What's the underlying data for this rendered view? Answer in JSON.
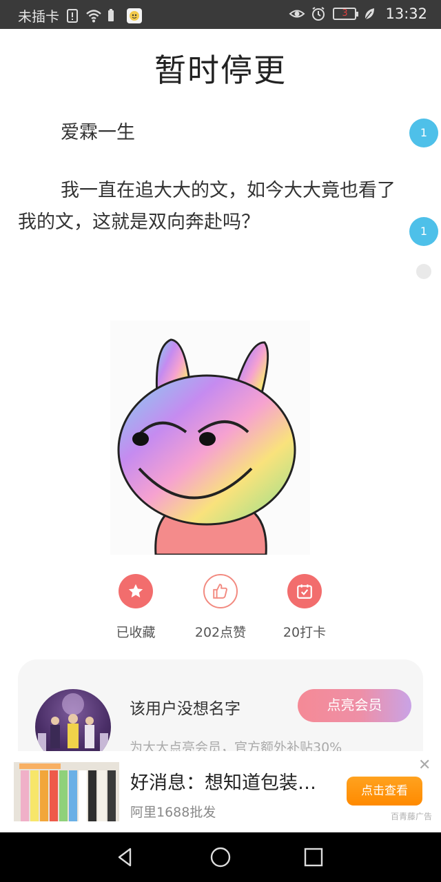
{
  "status_bar": {
    "carrier": "未插卡",
    "battery": "3",
    "time": "13:32",
    "icons": [
      "sim-alert-icon",
      "wifi-icon",
      "battery-saver-icon",
      "app-icon",
      "eye-icon",
      "alarm-icon",
      "battery-icon",
      "leaf-icon"
    ]
  },
  "page": {
    "title": "暂时停更"
  },
  "content": {
    "paragraph1": "爱霖一生",
    "paragraph2": "我一直在追大大的文，如今大大竟也看了我的文，这就是双向奔赴吗？",
    "comment_counts": [
      "1",
      "1"
    ]
  },
  "actions": [
    {
      "label": "已收藏",
      "icon": "star-icon"
    },
    {
      "label": "202点赞",
      "icon": "thumbs-up-icon"
    },
    {
      "label": "20打卡",
      "icon": "calendar-check-icon"
    }
  ],
  "member_card": {
    "name": "该用户没想名字",
    "subtitle": "为大大点亮会员，官方额外补贴30%",
    "button": "点亮会员"
  },
  "ad": {
    "title": "好消息：想知道包装…",
    "source": "阿里1688批发",
    "button": "点击查看",
    "close": "✕",
    "tag": "百青藤广告"
  },
  "nav": {
    "icons": [
      "back-icon",
      "home-icon",
      "recents-icon"
    ]
  },
  "colors": {
    "accent_blue": "#4ec0e9",
    "action_red": "#f26d6d",
    "ad_orange": "#ff8a00"
  }
}
